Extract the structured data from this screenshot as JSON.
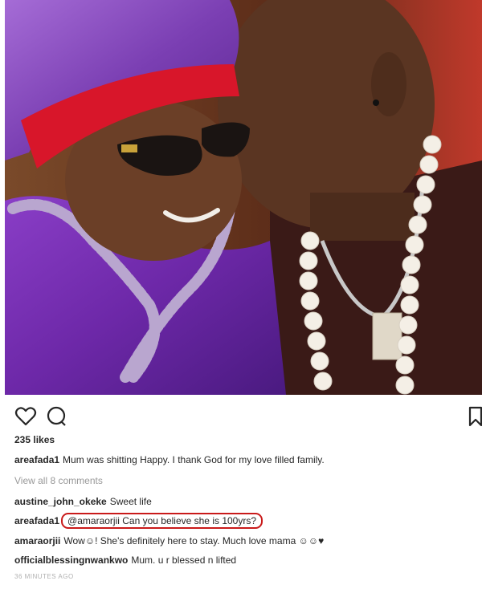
{
  "post": {
    "image_alt": "",
    "likes": "235 likes",
    "caption": {
      "user": "areafada1",
      "text": "Mum was shitting Happy. I thank God for my love filled family."
    },
    "view_all": "View all 8 comments",
    "comments": [
      {
        "user": "austine_john_okeke",
        "text": "Sweet life"
      },
      {
        "user": "areafada1",
        "text": "@amaraorjii Can you believe she is 100yrs?"
      },
      {
        "user": "amaraorjii",
        "text": "Wow☺! She's definitely here to stay. Much love mama ☺☺♥"
      },
      {
        "user": "officialblessingnwankwo",
        "text": "Mum. u r blessed n lifted"
      }
    ],
    "timestamp": "36 MINUTES AGO"
  },
  "icons": {
    "like": "heart-outline-icon",
    "comment": "comment-bubble-icon",
    "save": "bookmark-icon"
  },
  "colors": {
    "highlight": "#c91a1a",
    "muted": "#999999"
  }
}
